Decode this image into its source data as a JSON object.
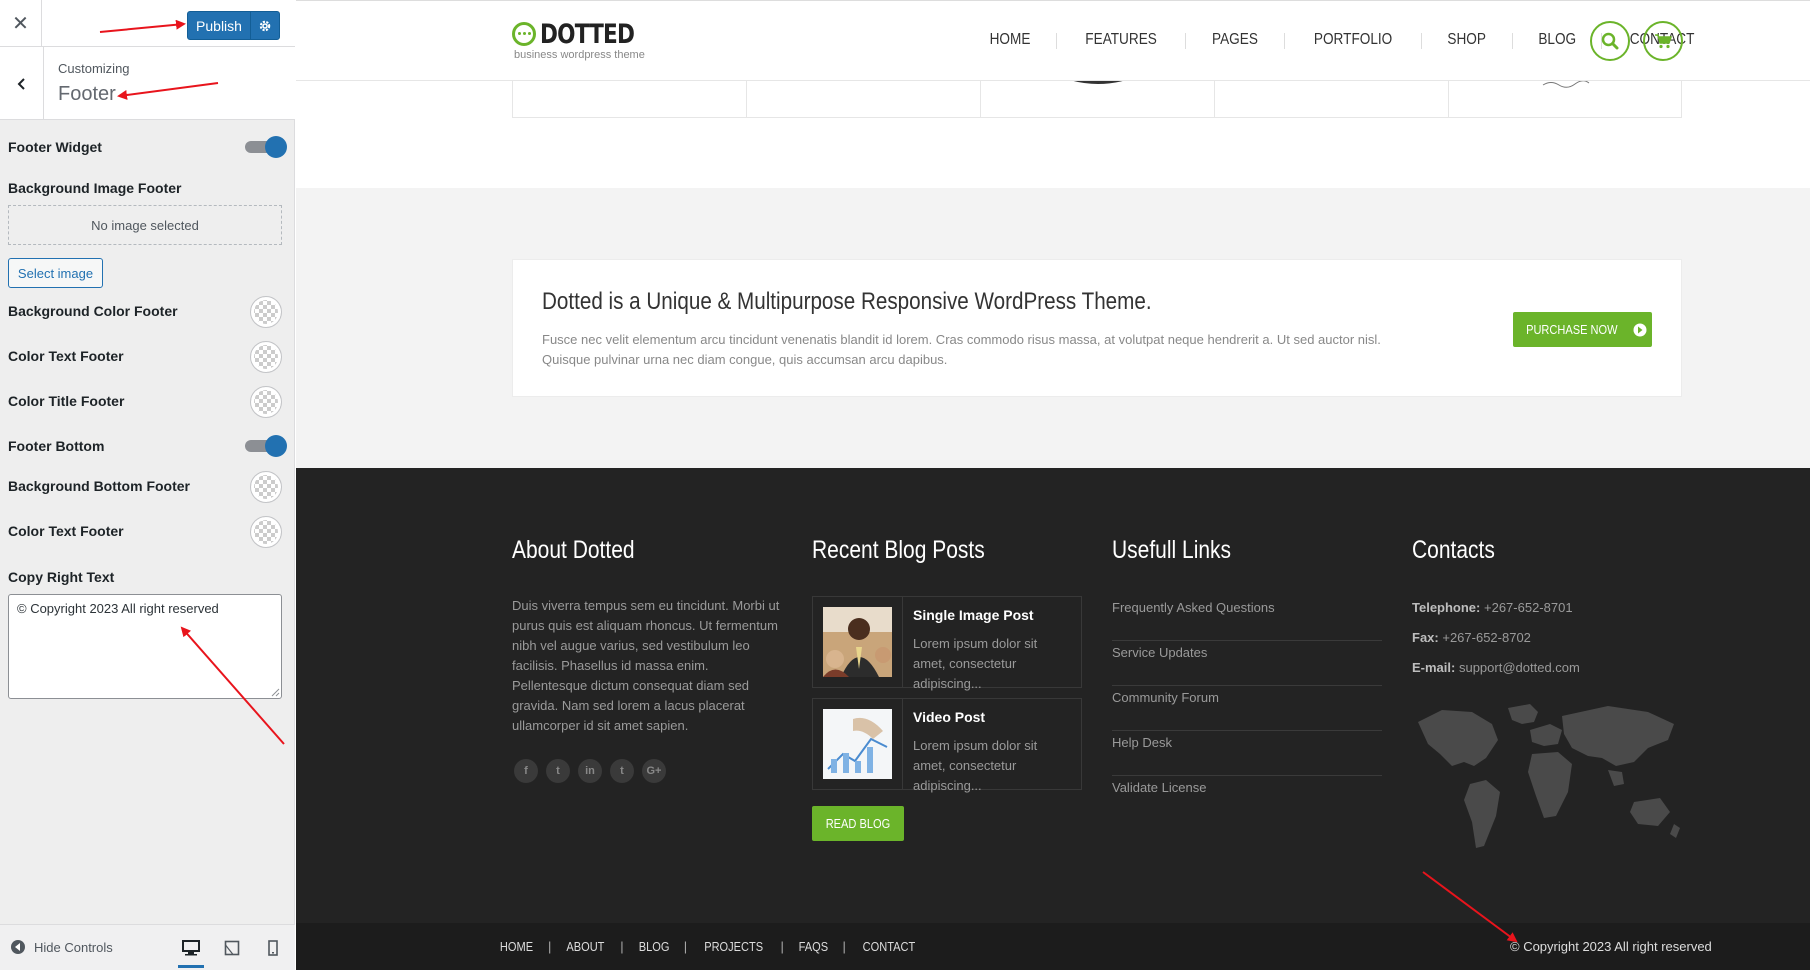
{
  "customizer": {
    "publish_label": "Publish",
    "customizing_label": "Customizing",
    "section_title": "Footer",
    "controls": {
      "footer_widget": "Footer Widget",
      "bg_image_footer": "Background Image Footer",
      "no_image": "No image selected",
      "select_image": "Select image",
      "bg_color_footer": "Background Color Footer",
      "color_text_footer": "Color Text Footer",
      "color_title_footer": "Color Title Footer",
      "footer_bottom": "Footer Bottom",
      "bg_bottom_footer": "Background Bottom Footer",
      "color_text_footer_2": "Color Text Footer",
      "copy_right_text": "Copy Right Text",
      "copy_right_value": "© Copyright 2023 All right reserved"
    },
    "hide_controls": "Hide Controls",
    "toggle_color": "#2271b1",
    "accent": "#2271b1"
  },
  "site": {
    "logo_text": "DOTTED",
    "tagline": "business wordpress theme",
    "brand_color": "#6bb42a",
    "nav": [
      "HOME",
      "FEATURES",
      "PAGES",
      "PORTFOLIO",
      "SHOP",
      "BLOG",
      "CONTACT"
    ],
    "promo": {
      "title": "Dotted is a Unique & Multipurpose Responsive WordPress Theme.",
      "text": "Fusce nec velit elementum arcu tincidunt venenatis blandit id lorem. Cras commodo risus massa, at volutpat neque hendrerit a. Ut sed auctor nisl. Quisque pulvinar urna nec diam congue, quis accumsan arcu dapibus.",
      "button": "PURCHASE NOW"
    },
    "footer": {
      "about_title": "About Dotted",
      "about_text": "Duis viverra tempus sem eu tincidunt. Morbi ut purus quis est aliquam rhoncus. Ut fermentum nibh vel augue varius, sed vestibulum leo facilisis. Phasellus id massa enim. Pellentesque dictum consequat diam sed gravida. Nam sed lorem a lacus placerat ullamcorper id sit amet sapien.",
      "socials": [
        "f",
        "t",
        "in",
        "t",
        "G+"
      ],
      "blog_title": "Recent Blog Posts",
      "posts": [
        {
          "title": "Single Image Post",
          "excerpt": "Lorem ipsum dolor sit amet, consectetur adipiscing..."
        },
        {
          "title": "Video Post",
          "excerpt": "Lorem ipsum dolor sit amet, consectetur adipiscing..."
        }
      ],
      "read_blog": "READ BLOG",
      "links_title": "Usefull Links",
      "links": [
        "Frequently Asked Questions",
        "Service Updates",
        "Community Forum",
        "Help Desk",
        "Validate License"
      ],
      "contacts_title": "Contacts",
      "telephone_label": "Telephone:",
      "telephone": "+267-652-8701",
      "fax_label": "Fax:",
      "fax": "+267-652-8702",
      "email_label": "E-mail:",
      "email": "support@dotted.com"
    },
    "bottom_nav": [
      "HOME",
      "ABOUT",
      "BLOG",
      "PROJECTS",
      "FAQS",
      "CONTACT"
    ],
    "copyright": "© Copyright 2023 All right reserved"
  }
}
